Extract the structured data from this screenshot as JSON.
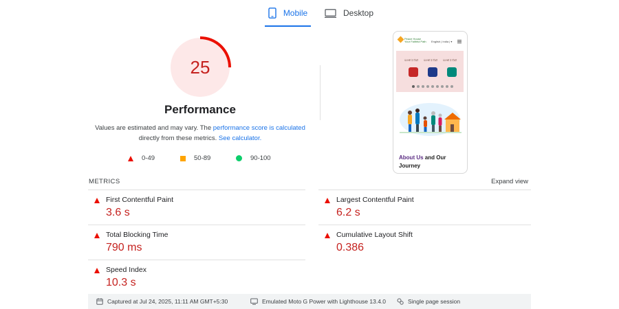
{
  "tabs": [
    {
      "label": "Mobile",
      "icon": "smartphone-icon",
      "active": true
    },
    {
      "label": "Desktop",
      "icon": "monitor-icon",
      "active": false
    }
  ],
  "performance": {
    "score": "25",
    "score_value": 25,
    "title": "Performance",
    "desc_prefix": "Values are estimated and may vary. The ",
    "desc_link1": "performance score is calculated",
    "desc_mid": " directly from these metrics. ",
    "desc_link2": "See calculator."
  },
  "legend": [
    {
      "label": "0-49",
      "shape": "triangle",
      "color": "#eb0f00"
    },
    {
      "label": "50-89",
      "shape": "square",
      "color": "#ffa400"
    },
    {
      "label": "90-100",
      "shape": "circle",
      "color": "#0cce6b"
    }
  ],
  "preview": {
    "logo_line1": "Peace House",
    "logo_line2": "Your Faithful Path",
    "lang": "English | India | ▾",
    "cards": [
      "ਪੰਜਾਬੀ ਤੇ ਹਿੰਦੀ",
      "ਪੰਜਾਬੀ ਤੇ ਹਿੰਦੀ",
      "ਪੰਜਾਬੀ ਤੇ ਹਿੰਦੀ"
    ],
    "about_highlight": "About Us",
    "about_rest": " and Our",
    "about_line2": "Journey"
  },
  "metrics": {
    "label": "METRICS",
    "expand_label": "Expand view",
    "items": [
      {
        "name": "First Contentful Paint",
        "value": "3.6 s"
      },
      {
        "name": "Largest Contentful Paint",
        "value": "6.2 s"
      },
      {
        "name": "Total Blocking Time",
        "value": "790 ms"
      },
      {
        "name": "Cumulative Layout Shift",
        "value": "0.386"
      },
      {
        "name": "Speed Index",
        "value": "10.3 s"
      }
    ]
  },
  "footer": {
    "captured": "Captured at Jul 24, 2025, 11:11 AM GMT+5:30",
    "device": "Emulated Moto G Power with Lighthouse 13.4.0",
    "session": "Single page session"
  },
  "colors": {
    "accent": "#1a73e8",
    "fail": "#eb0f00",
    "fail_text": "#c5221f",
    "average": "#ffa400",
    "pass": "#0cce6b",
    "gauge_bg": "#fde8e8"
  }
}
